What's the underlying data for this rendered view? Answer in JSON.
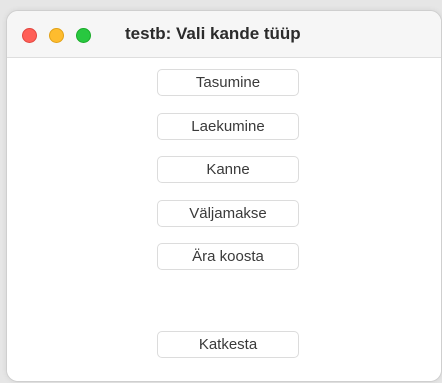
{
  "window": {
    "title": "testb: Vali kande tüüp"
  },
  "buttons": {
    "tasumine": "Tasumine",
    "laekumine": "Laekumine",
    "kanne": "Kanne",
    "valjamakse": "Väljamakse",
    "ara_koosta": "Ära koosta",
    "katkesta": "Katkesta"
  },
  "colors": {
    "close": "#ff5f57",
    "minimize": "#febc2e",
    "zoom": "#28c840"
  }
}
